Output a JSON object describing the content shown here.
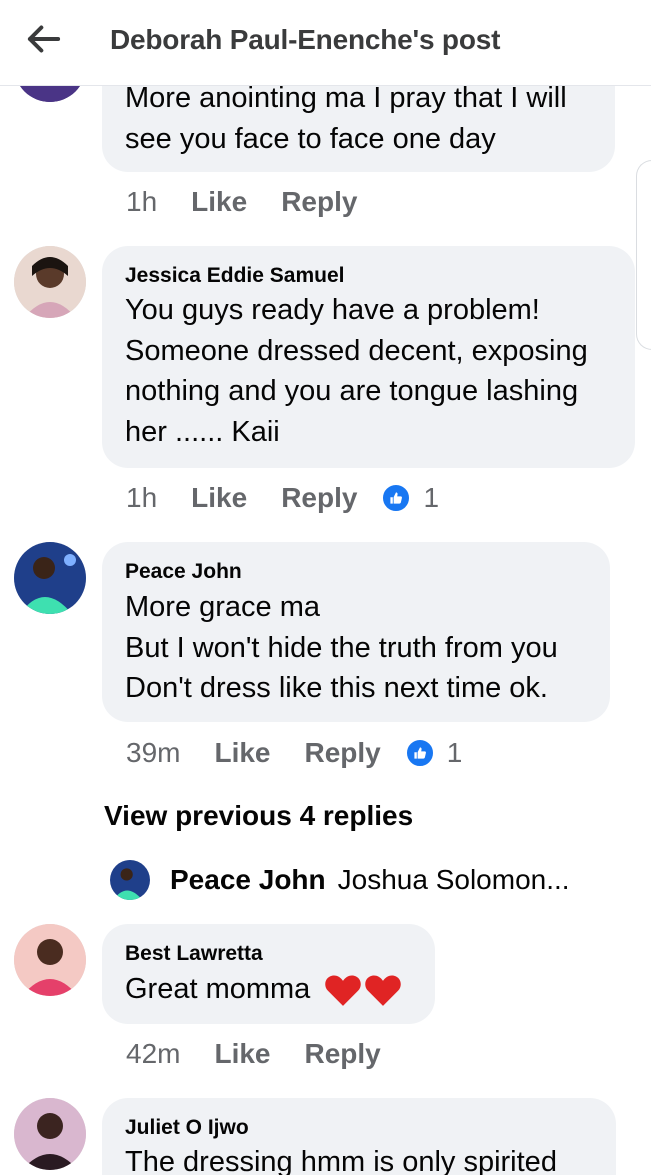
{
  "header": {
    "title": "Deborah Paul-Enenche's post",
    "back_icon": "arrow-left-icon"
  },
  "comments": [
    {
      "author": "",
      "lines": [
        "More anointing ma I pray that I will",
        "see you face to face one day"
      ],
      "time": "1h",
      "like_label": "Like",
      "reply_label": "Reply"
    },
    {
      "author": "Jessica Eddie Samuel",
      "lines": [
        "You guys ready have a problem!",
        "Someone dressed decent, exposing",
        "nothing and you are tongue lashing",
        "her ...... Kaii"
      ],
      "time": "1h",
      "like_label": "Like",
      "reply_label": "Reply",
      "reactions": "1"
    },
    {
      "author": "Peace John",
      "lines": [
        "More grace ma",
        "But I won't hide the truth from you",
        "Don't dress like this next time ok."
      ],
      "time": "39m",
      "like_label": "Like",
      "reply_label": "Reply",
      "reactions": "1"
    },
    {
      "author": "Best Lawretta",
      "text": "Great momma",
      "time": "42m",
      "like_label": "Like",
      "reply_label": "Reply"
    },
    {
      "author": "Juliet O Ijwo",
      "lines": [
        "The dressing hmm is only spirited"
      ]
    }
  ],
  "replies": {
    "view_previous_label": "View previous 4 replies",
    "latest_author": "Peace John",
    "latest_snippet": "Joshua Solomon..."
  },
  "colors": {
    "bubble": "#f0f2f5",
    "meta_text": "#65676b",
    "like_blue": "#1877f2",
    "heart_red": "#e02424"
  }
}
